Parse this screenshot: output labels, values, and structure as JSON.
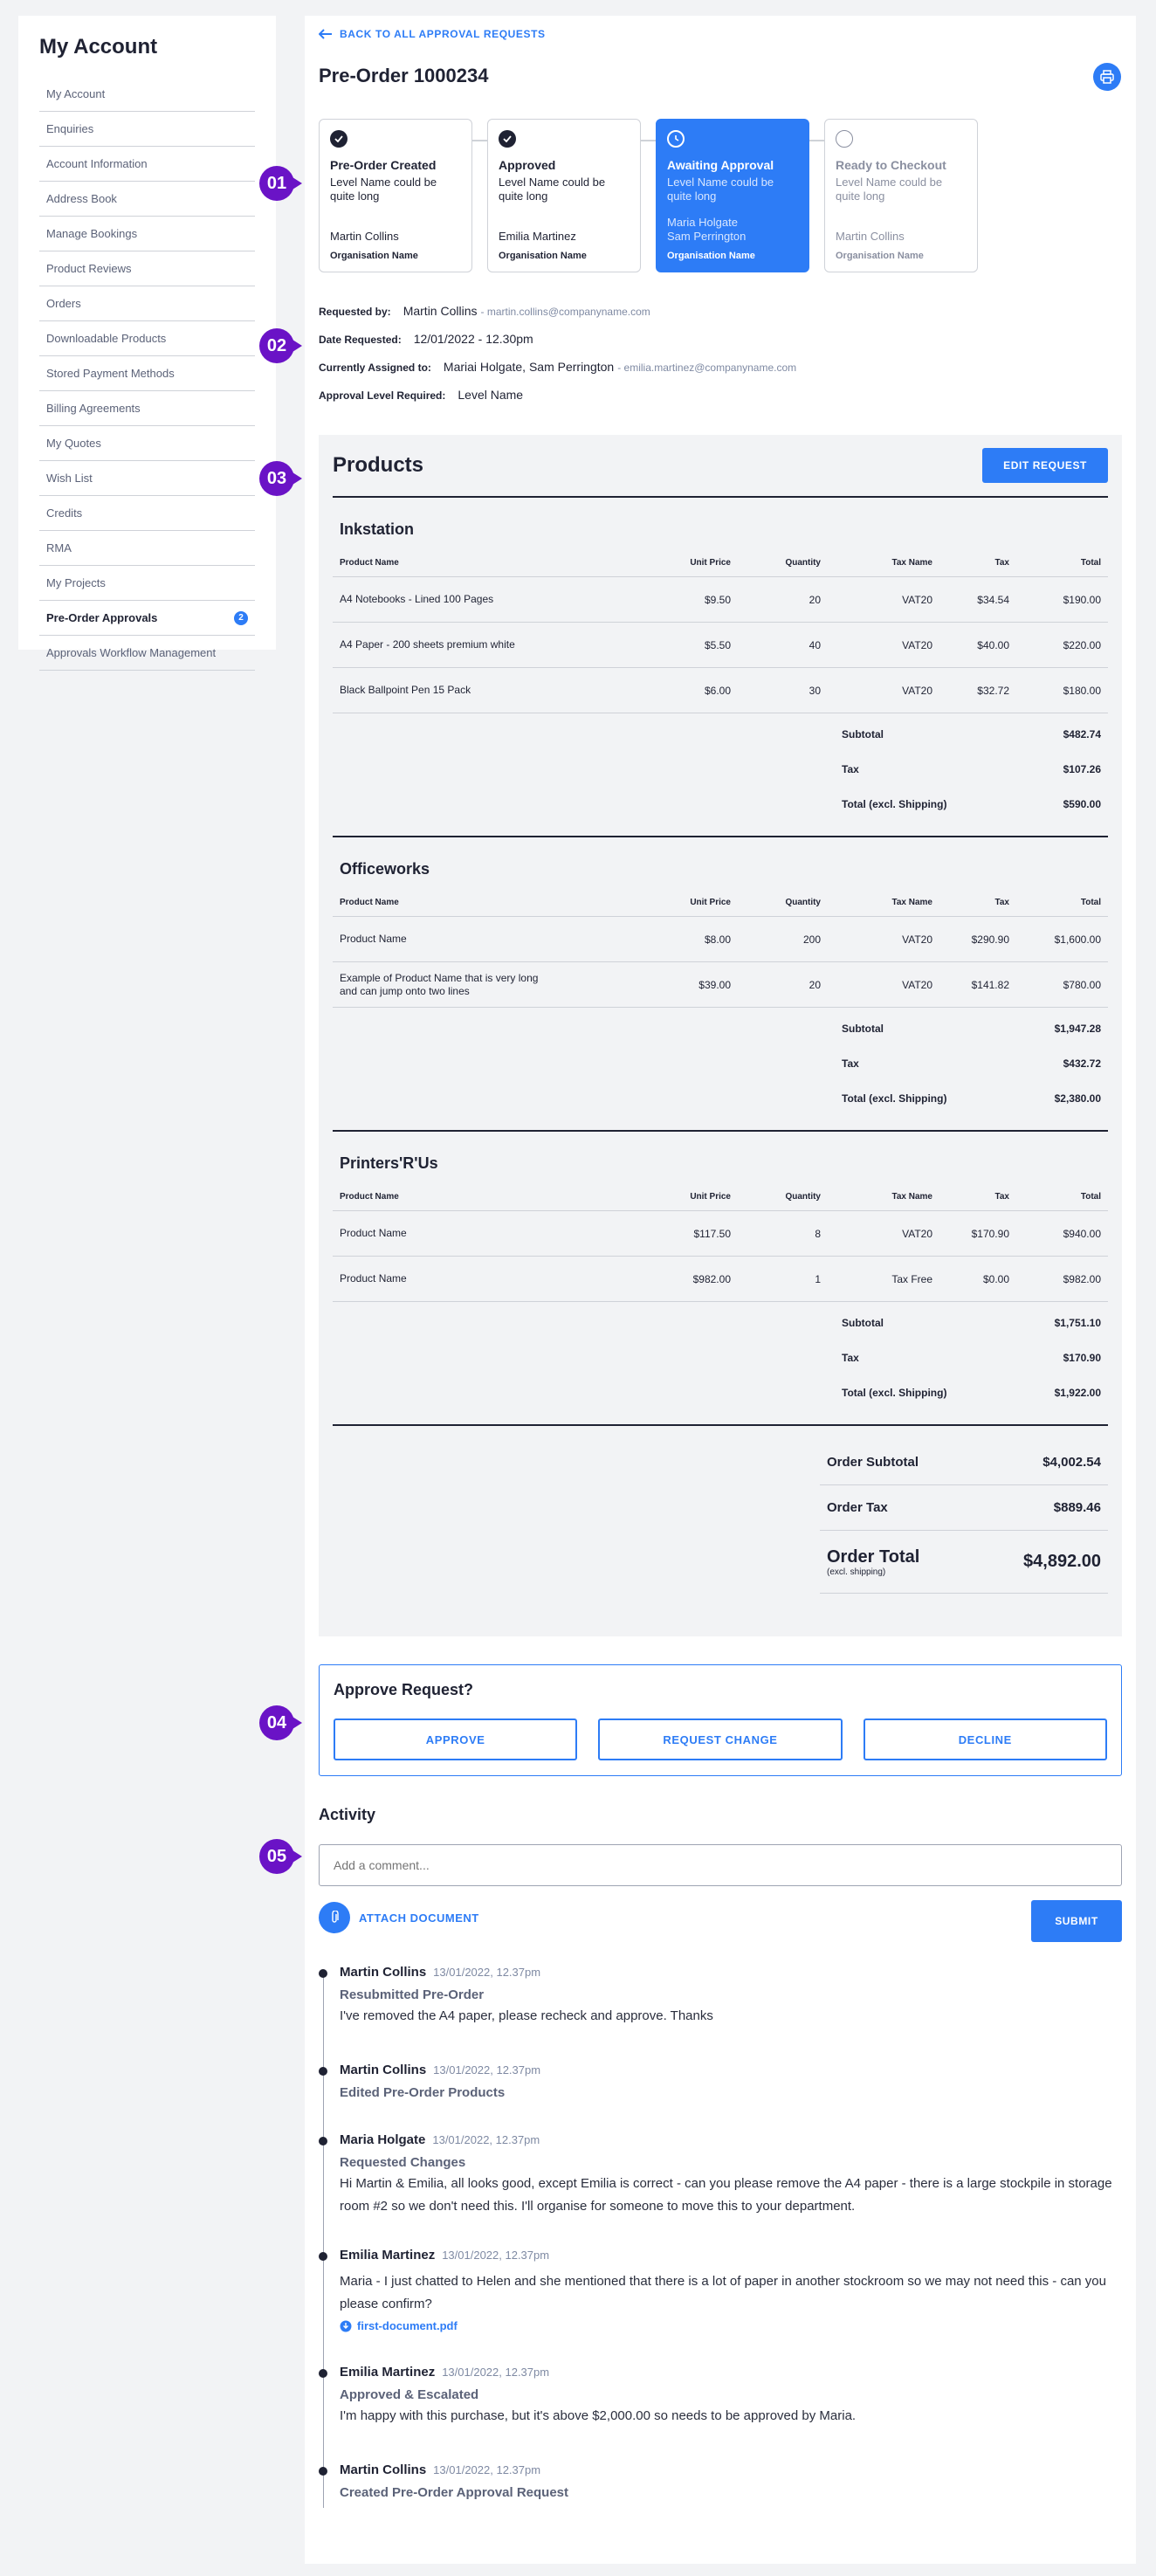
{
  "sidebar": {
    "title": "My Account",
    "items": [
      {
        "label": "My Account"
      },
      {
        "label": "Enquiries"
      },
      {
        "label": "Account Information"
      },
      {
        "label": "Address Book"
      },
      {
        "label": "Manage Bookings"
      },
      {
        "label": "Product Reviews"
      },
      {
        "label": "Orders"
      },
      {
        "label": "Downloadable Products"
      },
      {
        "label": "Stored Payment Methods"
      },
      {
        "label": "Billing Agreements"
      },
      {
        "label": "My Quotes"
      },
      {
        "label": "Wish List"
      },
      {
        "label": "Credits"
      },
      {
        "label": "RMA"
      },
      {
        "label": "My Projects"
      },
      {
        "label": "Pre-Order Approvals",
        "badge": "2",
        "active": true
      },
      {
        "label": "Approvals Workflow Management"
      }
    ]
  },
  "header": {
    "back_label": "BACK TO ALL APPROVAL REQUESTS",
    "title": "Pre-Order 1000234",
    "print_icon": "printer-icon"
  },
  "markers": [
    "01",
    "02",
    "03",
    "04",
    "05"
  ],
  "steps": [
    {
      "title": "Pre-Order Created",
      "desc": "Level Name could be quite long",
      "names": "Martin Collins",
      "org": "Organisation Name",
      "state": "done"
    },
    {
      "title": "Approved",
      "desc": "Level Name could be quite long",
      "names": "Emilia Martinez",
      "org": "Organisation Name",
      "state": "done"
    },
    {
      "title": "Awaiting Approval",
      "desc": "Level Name could be quite long",
      "names": "Maria Holgate\nSam Perrington",
      "org": "Organisation Name",
      "state": "current"
    },
    {
      "title": "Ready to Checkout",
      "desc": "Level Name could be quite long",
      "names": "Martin Collins",
      "org": "Organisation Name",
      "state": "future"
    }
  ],
  "info": {
    "requested_by_label": "Requested by:",
    "requested_by": "Martin Collins",
    "requested_by_email": "- martin.collins@companyname.com",
    "date_label": "Date Requested:",
    "date": "12/01/2022 - 12.30pm",
    "assigned_label": "Currently Assigned to:",
    "assigned": "Mariai Holgate, Sam Perrington",
    "assigned_email": "- emilia.martinez@companyname.com",
    "level_label": "Approval Level Required:",
    "level": "Level Name"
  },
  "products": {
    "title": "Products",
    "edit_label": "EDIT REQUEST",
    "columns": [
      "Product Name",
      "Unit Price",
      "Quantity",
      "Tax Name",
      "Tax",
      "Total"
    ],
    "subtotal_labels": [
      "Subtotal",
      "Tax",
      "Total (excl. Shipping)"
    ],
    "suppliers": [
      {
        "name": "Inkstation",
        "items": [
          [
            "A4 Notebooks - Lined 100 Pages",
            "$9.50",
            "20",
            "VAT20",
            "$34.54",
            "$190.00"
          ],
          [
            "A4 Paper - 200 sheets premium white",
            "$5.50",
            "40",
            "VAT20",
            "$40.00",
            "$220.00"
          ],
          [
            "Black Ballpoint Pen 15 Pack",
            "$6.00",
            "30",
            "VAT20",
            "$32.72",
            "$180.00"
          ]
        ],
        "totals": [
          "$482.74",
          "$107.26",
          "$590.00"
        ]
      },
      {
        "name": "Officeworks",
        "items": [
          [
            "Product Name",
            "$8.00",
            "200",
            "VAT20",
            "$290.90",
            "$1,600.00"
          ],
          [
            "Example of Product Name that is very long and can jump onto two lines",
            "$39.00",
            "20",
            "VAT20",
            "$141.82",
            "$780.00"
          ]
        ],
        "totals": [
          "$1,947.28",
          "$432.72",
          "$2,380.00"
        ]
      },
      {
        "name": "Printers'R'Us",
        "items": [
          [
            "Product Name",
            "$117.50",
            "8",
            "VAT20",
            "$170.90",
            "$940.00"
          ],
          [
            "Product Name",
            "$982.00",
            "1",
            "Tax Free",
            "$0.00",
            "$982.00"
          ]
        ],
        "totals": [
          "$1,751.10",
          "$170.90",
          "$1,922.00"
        ]
      }
    ],
    "order": {
      "subtotal_label": "Order Subtotal",
      "subtotal": "$4,002.54",
      "tax_label": "Order Tax",
      "tax": "$889.46",
      "total_label": "Order Total",
      "total_note": "(excl. shipping)",
      "total": "$4,892.00"
    }
  },
  "approve": {
    "title": "Approve Request?",
    "approve_label": "APPROVE",
    "change_label": "REQUEST CHANGE",
    "decline_label": "DECLINE"
  },
  "activity": {
    "title": "Activity",
    "placeholder": "Add a comment...",
    "attach_label": "ATTACH DOCUMENT",
    "submit_label": "SUBMIT",
    "events": [
      {
        "who": "Martin Collins",
        "when": "13/01/2022, 12.37pm",
        "action": "Resubmitted Pre-Order",
        "message": "I've removed the A4 paper, please recheck and approve. Thanks"
      },
      {
        "who": "Martin Collins",
        "when": "13/01/2022, 12.37pm",
        "action": "Edited Pre-Order Products"
      },
      {
        "who": "Maria Holgate",
        "when": "13/01/2022, 12.37pm",
        "action": "Requested Changes",
        "message": "Hi Martin & Emilia, all looks good, except Emilia is correct - can you please remove the A4 paper - there is a large stockpile in storage room #2 so we don't need this. I'll organise for someone to move this to your department."
      },
      {
        "who": "Emilia Martinez",
        "when": "13/01/2022, 12.37pm",
        "message": "Maria - I just chatted to Helen and she mentioned that there is a lot of paper in another stockroom so we may not need this - can you please confirm?",
        "file": "first-document.pdf"
      },
      {
        "who": "Emilia Martinez",
        "when": "13/01/2022, 12.37pm",
        "action": "Approved & Escalated",
        "message": "I'm happy with this purchase, but it's above $2,000.00 so needs to be approved by Maria."
      },
      {
        "who": "Martin Collins",
        "when": "13/01/2022, 12.37pm",
        "action": "Created Pre-Order Approval Request"
      }
    ]
  }
}
